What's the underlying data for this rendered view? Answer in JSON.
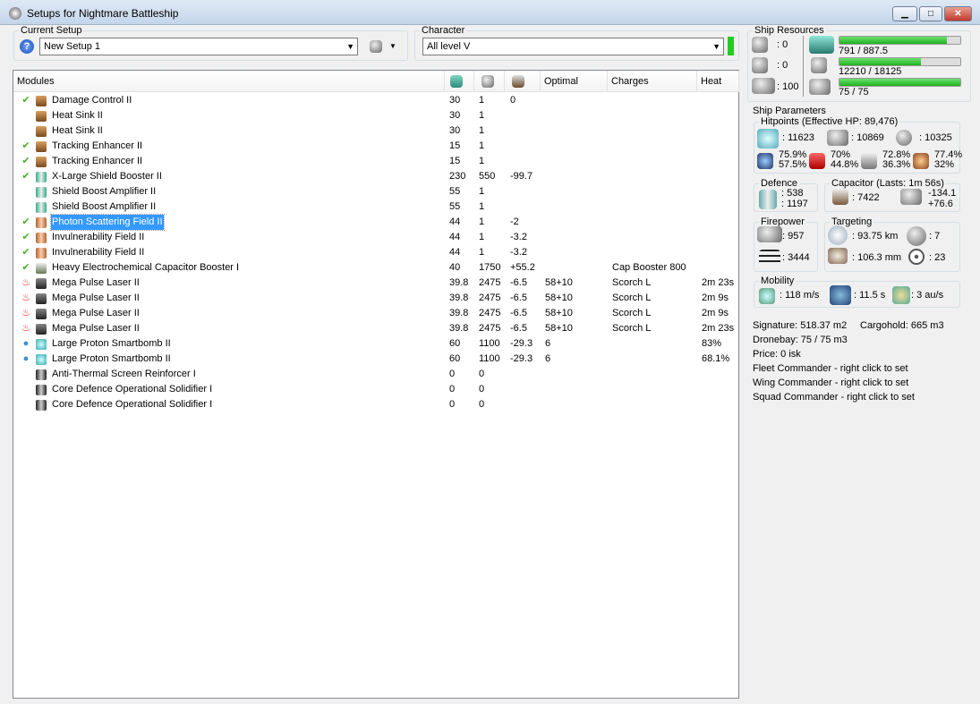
{
  "window": {
    "title": "Setups for Nightmare Battleship",
    "minimize": "▁",
    "maximize": "□",
    "close": "✕"
  },
  "setup": {
    "label": "Current Setup",
    "value": "New Setup 1",
    "help_icon": "question-icon",
    "tools_icon": "drone-tools-icon"
  },
  "character": {
    "label": "Character",
    "value": "All level V",
    "status_color": "#22cc22"
  },
  "modules": {
    "columns": [
      "Modules",
      "cpu-icon",
      "powergrid-icon",
      "capacitor-icon",
      "Optimal",
      "Charges",
      "Heat"
    ],
    "rows": [
      {
        "status": "check",
        "name": "Damage Control II",
        "cpu": "30",
        "pg": "1",
        "cap": "0",
        "optimal": "",
        "charges": "",
        "heat": ""
      },
      {
        "status": "",
        "name": "Heat Sink II",
        "cpu": "30",
        "pg": "1",
        "cap": "",
        "optimal": "",
        "charges": "",
        "heat": ""
      },
      {
        "status": "",
        "name": "Heat Sink II",
        "cpu": "30",
        "pg": "1",
        "cap": "",
        "optimal": "",
        "charges": "",
        "heat": ""
      },
      {
        "status": "check",
        "name": "Tracking Enhancer II",
        "cpu": "15",
        "pg": "1",
        "cap": "",
        "optimal": "",
        "charges": "",
        "heat": ""
      },
      {
        "status": "check",
        "name": "Tracking Enhancer II",
        "cpu": "15",
        "pg": "1",
        "cap": "",
        "optimal": "",
        "charges": "",
        "heat": ""
      },
      {
        "status": "check",
        "name": "X-Large Shield Booster II",
        "cpu": "230",
        "pg": "550",
        "cap": "-99.7",
        "optimal": "",
        "charges": "",
        "heat": ""
      },
      {
        "status": "",
        "name": "Shield Boost Amplifier II",
        "cpu": "55",
        "pg": "1",
        "cap": "",
        "optimal": "",
        "charges": "",
        "heat": ""
      },
      {
        "status": "",
        "name": "Shield Boost Amplifier II",
        "cpu": "55",
        "pg": "1",
        "cap": "",
        "optimal": "",
        "charges": "",
        "heat": ""
      },
      {
        "status": "check",
        "name": "Photon Scattering Field II",
        "cpu": "44",
        "pg": "1",
        "cap": "-2",
        "optimal": "",
        "charges": "",
        "heat": "",
        "selected": true
      },
      {
        "status": "check",
        "name": "Invulnerability Field II",
        "cpu": "44",
        "pg": "1",
        "cap": "-3.2",
        "optimal": "",
        "charges": "",
        "heat": ""
      },
      {
        "status": "check",
        "name": "Invulnerability Field II",
        "cpu": "44",
        "pg": "1",
        "cap": "-3.2",
        "optimal": "",
        "charges": "",
        "heat": ""
      },
      {
        "status": "check",
        "name": "Heavy Electrochemical Capacitor Booster I",
        "cpu": "40",
        "pg": "1750",
        "cap": "+55.2",
        "optimal": "",
        "charges": "Cap Booster 800",
        "heat": ""
      },
      {
        "status": "overheat",
        "name": "Mega Pulse Laser II",
        "cpu": "39.8",
        "pg": "2475",
        "cap": "-6.5",
        "optimal": "58+10",
        "charges": "Scorch L",
        "heat": "2m 23s"
      },
      {
        "status": "overheat",
        "name": "Mega Pulse Laser II",
        "cpu": "39.8",
        "pg": "2475",
        "cap": "-6.5",
        "optimal": "58+10",
        "charges": "Scorch L",
        "heat": "2m 9s"
      },
      {
        "status": "overheat",
        "name": "Mega Pulse Laser II",
        "cpu": "39.8",
        "pg": "2475",
        "cap": "-6.5",
        "optimal": "58+10",
        "charges": "Scorch L",
        "heat": "2m 9s"
      },
      {
        "status": "overheat",
        "name": "Mega Pulse Laser II",
        "cpu": "39.8",
        "pg": "2475",
        "cap": "-6.5",
        "optimal": "58+10",
        "charges": "Scorch L",
        "heat": "2m 23s"
      },
      {
        "status": "active",
        "name": "Large Proton Smartbomb II",
        "cpu": "60",
        "pg": "1100",
        "cap": "-29.3",
        "optimal": "6",
        "charges": "",
        "heat": "83%"
      },
      {
        "status": "active",
        "name": "Large Proton Smartbomb II",
        "cpu": "60",
        "pg": "1100",
        "cap": "-29.3",
        "optimal": "6",
        "charges": "",
        "heat": "68.1%"
      },
      {
        "status": "",
        "name": "Anti-Thermal Screen Reinforcer I",
        "cpu": "0",
        "pg": "0",
        "cap": "",
        "optimal": "",
        "charges": "",
        "heat": ""
      },
      {
        "status": "",
        "name": "Core Defence Operational Solidifier I",
        "cpu": "0",
        "pg": "0",
        "cap": "",
        "optimal": "",
        "charges": "",
        "heat": ""
      },
      {
        "status": "",
        "name": "Core Defence Operational Solidifier I",
        "cpu": "0",
        "pg": "0",
        "cap": "",
        "optimal": "",
        "charges": "",
        "heat": ""
      }
    ]
  },
  "resources": {
    "label": "Ship Resources",
    "turrets": ": 0",
    "launchers": ": 0",
    "calibration": ": 100",
    "cpu": {
      "text": "791 / 887.5",
      "fraction": 0.891
    },
    "powergrid": {
      "text": "12210 / 18125",
      "fraction": 0.674
    },
    "drone_bandwidth": {
      "text": "75 / 75",
      "fraction": 1.0
    }
  },
  "parameters": {
    "label": "Ship Parameters",
    "hitpoints": {
      "label": "Hitpoints (Effective HP: 89,476)",
      "shield": ": 11623",
      "armor": ": 10869",
      "structure": ": 10325",
      "resists": [
        {
          "type": "em",
          "a": "75.9%",
          "b": "57.5%"
        },
        {
          "type": "thermal",
          "a": "70%",
          "b": "44.8%"
        },
        {
          "type": "kinetic",
          "a": "72.8%",
          "b": "36.3%"
        },
        {
          "type": "explosive",
          "a": "77.4%",
          "b": "32%"
        }
      ]
    },
    "defence": {
      "label": "Defence",
      "a": ": 538",
      "b": ": 1197"
    },
    "capacitor": {
      "label": "Capacitor (Lasts: 1m 56s)",
      "amount": ": 7422",
      "a": "-134.1",
      "b": "+76.6"
    },
    "firepower": {
      "label": "Firepower",
      "dps": ": 957",
      "volley": ": 3444"
    },
    "targeting": {
      "label": "Targeting",
      "range": ": 93.75 km",
      "sensor": ": 106.3 mm",
      "targets": ": 7",
      "scan": ": 23"
    },
    "mobility": {
      "label": "Mobility",
      "speed": ": 118 m/s",
      "align": ": 11.5 s",
      "warp": ": 3 au/s"
    },
    "info": [
      "Signature: 518.37 m2",
      "Cargohold: 665 m3",
      "Dronebay: 75 / 75 m3",
      "Price: 0 isk",
      "Fleet Commander - right click to set",
      "Wing Commander - right click to set",
      "Squad Commander - right click to set"
    ]
  }
}
